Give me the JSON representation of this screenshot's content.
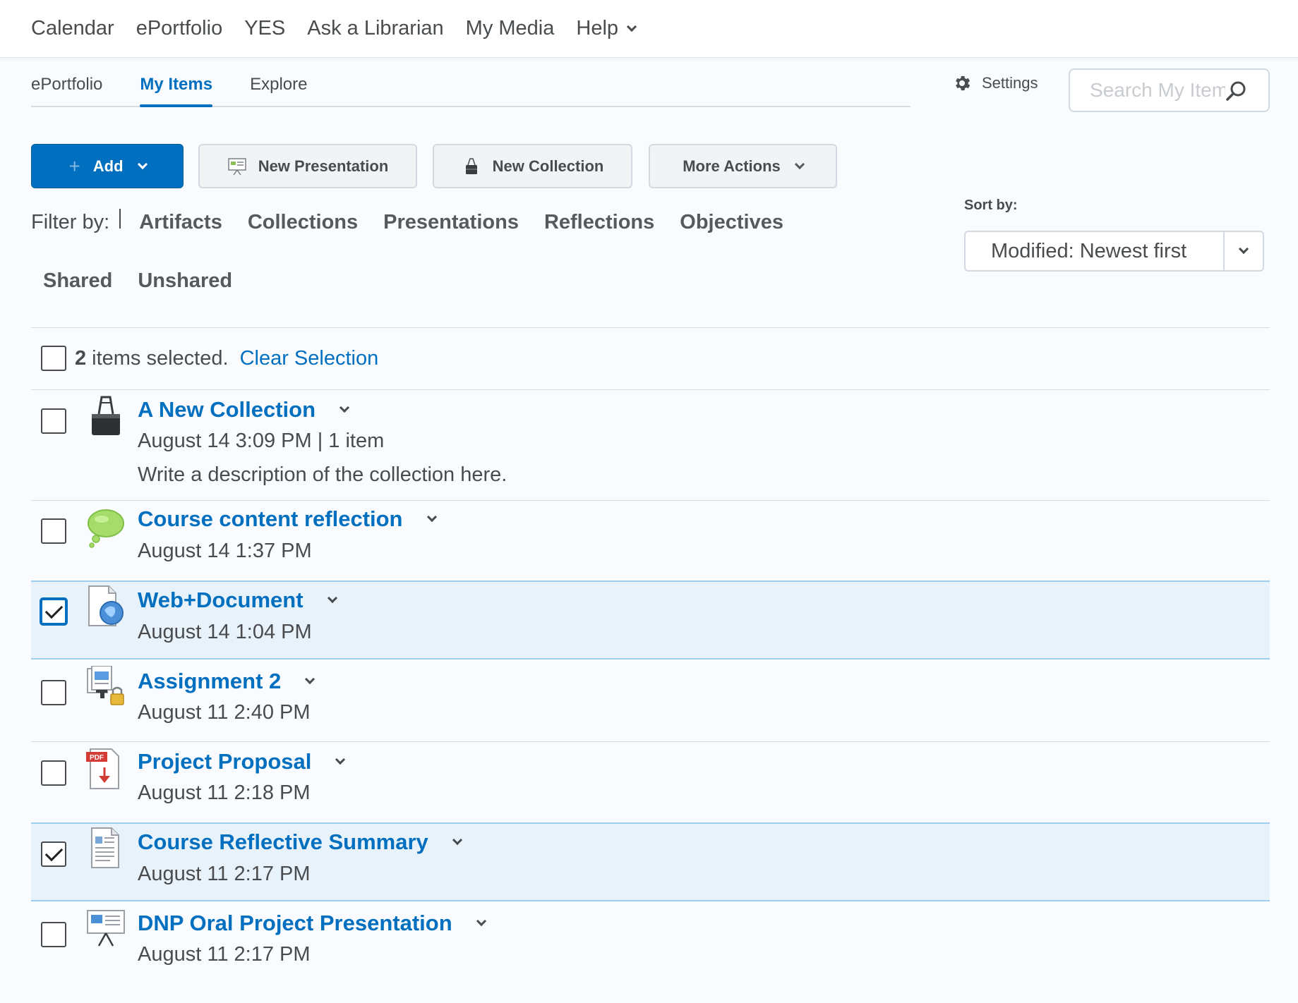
{
  "topnav": {
    "items": [
      "Calendar",
      "ePortfolio",
      "YES",
      "Ask a Librarian",
      "My Media"
    ],
    "help_label": "Help"
  },
  "subtabs": {
    "items": [
      "ePortfolio",
      "My Items",
      "Explore"
    ],
    "active": "My Items"
  },
  "settings_label": "Settings",
  "search": {
    "placeholder": "Search My Items"
  },
  "actions": {
    "add_label": "Add",
    "new_presentation_label": "New Presentation",
    "new_collection_label": "New Collection",
    "more_actions_label": "More Actions"
  },
  "filters": {
    "label": "Filter by:",
    "row1": [
      "Artifacts",
      "Collections",
      "Presentations",
      "Reflections",
      "Objectives"
    ],
    "row2": [
      "Shared",
      "Unshared"
    ]
  },
  "sort": {
    "label": "Sort by:",
    "value": "Modified: Newest first"
  },
  "selection": {
    "count": "2",
    "text": "items selected.",
    "clear_label": "Clear Selection"
  },
  "items": [
    {
      "title": "A New Collection",
      "meta": "August 14 3:09 PM | 1 item",
      "description": "Write a description of the collection here.",
      "icon": "binder-clip-icon",
      "selected": false
    },
    {
      "title": "Course content reflection",
      "meta": "August 14 1:37 PM",
      "icon": "thought-bubble-icon",
      "selected": false
    },
    {
      "title": "Web+Document",
      "meta": "August 14 1:04 PM",
      "icon": "web-document-icon",
      "selected": true
    },
    {
      "title": "Assignment 2",
      "meta": "August 11 2:40 PM",
      "icon": "locked-assignment-icon",
      "selected": false
    },
    {
      "title": "Project Proposal",
      "meta": "August 11 2:18 PM",
      "icon": "pdf-file-icon",
      "selected": false
    },
    {
      "title": "Course Reflective Summary",
      "meta": "August 11 2:17 PM",
      "icon": "text-document-icon",
      "selected": true
    },
    {
      "title": "DNP Oral Project Presentation",
      "meta": "August 11 2:17 PM",
      "icon": "presentation-easel-icon",
      "selected": false
    }
  ],
  "colors": {
    "link": "#006fbf",
    "primary_button": "#006fbf",
    "selected_row": "#e8f2fb",
    "text": "#494c4e"
  }
}
